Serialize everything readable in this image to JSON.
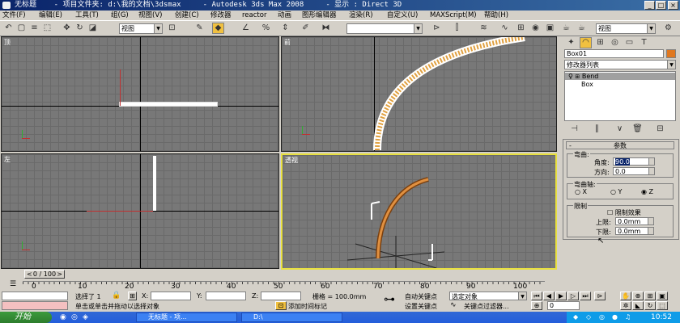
{
  "window": {
    "title": "无标题    - 项目文件夹: d:\\我的文档\\3dsmax     - Autodesk 3ds Max 2008     - 显示 : Direct 3D"
  },
  "menu": [
    "文件(F)",
    "编辑(E)",
    "工具(T)",
    "组(G)",
    "视图(V)",
    "创建(C)",
    "修改器",
    "reactor",
    "动画",
    "图形编辑器",
    "渲染(R)",
    "自定义(U)",
    "MAXScript(M)",
    "帮助(H)"
  ],
  "toolbar": {
    "view_combo": "视图",
    "selection_set_combo": "",
    "right_view_combo": "视图"
  },
  "viewports": {
    "top": {
      "label": "顶"
    },
    "front": {
      "label": "前"
    },
    "left": {
      "label": "左"
    },
    "perspective": {
      "label": "透视"
    }
  },
  "command_panel": {
    "object_name": "Box01",
    "object_color": "#e07820",
    "modifier_list": "修改器列表",
    "stack": [
      {
        "label": "Bend",
        "selected": true
      },
      {
        "label": "Box",
        "selected": false
      }
    ],
    "rollout_title": "参数",
    "bend_group": "弯曲:",
    "angle_label": "角度:",
    "angle_value": "90.0",
    "direction_label": "方向:",
    "direction_value": "0.0",
    "axis_group": "弯曲轴:",
    "axis_x": "X",
    "axis_y": "Y",
    "axis_z": "Z",
    "limit_group": "限制",
    "limit_effect": "限制效果",
    "upper_label": "上限:",
    "upper_value": "0.0mm",
    "lower_label": "下限:",
    "lower_value": "0.0mm"
  },
  "timeline": {
    "frame_display": "0 / 100",
    "ticks": [
      "0",
      "10",
      "20",
      "30",
      "40",
      "50",
      "60",
      "70",
      "80",
      "90",
      "100"
    ]
  },
  "status": {
    "selected": "选择了 1",
    "x_label": "X:",
    "y_label": "Y:",
    "z_label": "Z:",
    "x_value": "",
    "y_value": "",
    "z_value": "",
    "grid": "栅格 = 100.0mm",
    "prompt": "单击或单击并拖动以选择对象",
    "add_time_tag": "添加时间标记",
    "auto_key": "自动关键点",
    "set_key": "设置关键点",
    "selection_combo": "选定对象",
    "key_filters": "关键点过滤器...",
    "frame_field": "0"
  },
  "taskbar": {
    "start": "开始",
    "tasks": [
      "无标题 - 项...",
      "D:\\"
    ],
    "time": "10:52"
  }
}
